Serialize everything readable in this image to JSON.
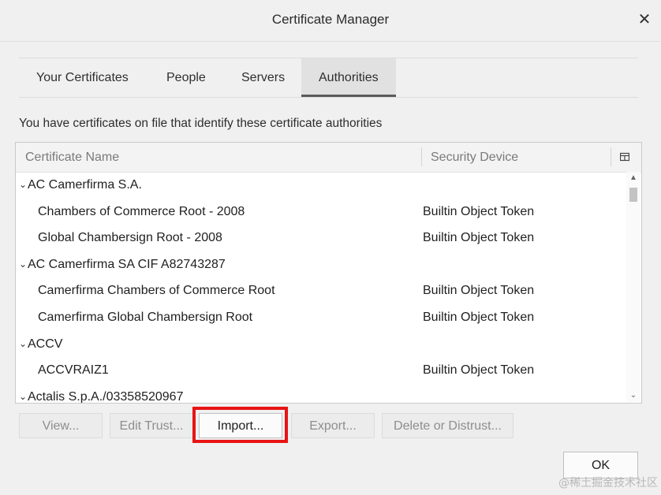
{
  "window": {
    "title": "Certificate Manager",
    "close_glyph": "✕"
  },
  "tabs": [
    {
      "label": "Your Certificates",
      "selected": false
    },
    {
      "label": "People",
      "selected": false
    },
    {
      "label": "Servers",
      "selected": false
    },
    {
      "label": "Authorities",
      "selected": true
    }
  ],
  "description": "You have certificates on file that identify these certificate authorities",
  "tree": {
    "columns": {
      "name": "Certificate Name",
      "device": "Security Device"
    },
    "rows": [
      {
        "type": "group",
        "name": "AC Camerfirma S.A.",
        "device": ""
      },
      {
        "type": "cert",
        "name": "Chambers of Commerce Root - 2008",
        "device": "Builtin Object Token"
      },
      {
        "type": "cert",
        "name": "Global Chambersign Root - 2008",
        "device": "Builtin Object Token"
      },
      {
        "type": "group",
        "name": "AC Camerfirma SA CIF A82743287",
        "device": ""
      },
      {
        "type": "cert",
        "name": "Camerfirma Chambers of Commerce Root",
        "device": "Builtin Object Token"
      },
      {
        "type": "cert",
        "name": "Camerfirma Global Chambersign Root",
        "device": "Builtin Object Token"
      },
      {
        "type": "group",
        "name": "ACCV",
        "device": ""
      },
      {
        "type": "cert",
        "name": "ACCVRAIZ1",
        "device": "Builtin Object Token"
      },
      {
        "type": "group",
        "name": "Actalis S.p.A./03358520967",
        "device": ""
      }
    ]
  },
  "buttons": {
    "view": "View...",
    "edit_trust": "Edit Trust...",
    "import": "Import...",
    "export": "Export...",
    "delete": "Delete or Distrust...",
    "ok": "OK"
  },
  "watermark": "@稀土掘金技术社区",
  "colors": {
    "highlight": "#e81313"
  }
}
